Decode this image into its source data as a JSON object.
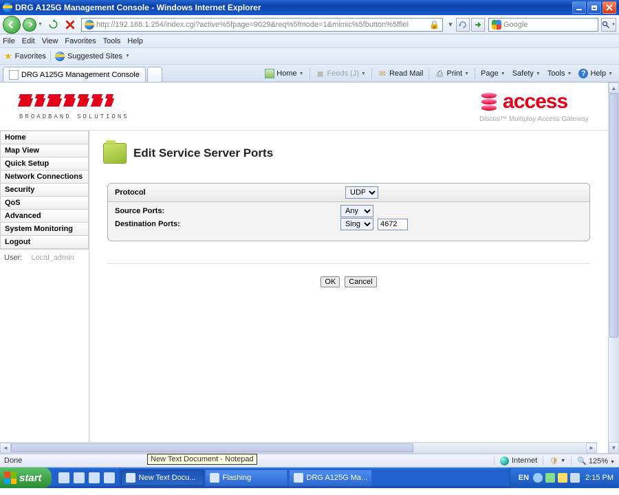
{
  "window": {
    "title": "DRG A125G Management Console - Windows Internet Explorer"
  },
  "address_bar": {
    "url": "http://192.168.1.254/index.cgi?active%5fpage=9029&req%5fmode=1&mimic%5fbutton%5ffiel"
  },
  "search_box": {
    "provider": "Google"
  },
  "menu": {
    "file": "File",
    "edit": "Edit",
    "view": "View",
    "favorites": "Favorites",
    "tools": "Tools",
    "help": "Help"
  },
  "favbar": {
    "favorites": "Favorites",
    "suggested": "Suggested Sites"
  },
  "tab": {
    "title": "DRG A125G Management Console"
  },
  "cmdbar": {
    "home": "Home",
    "feeds": "Feeds (J)",
    "readmail": "Read Mail",
    "print": "Print",
    "page": "Page",
    "safety": "Safety",
    "tools": "Tools",
    "help": "Help"
  },
  "banner": {
    "pirelli_sub": "BROADBAND SOLUTIONS",
    "access": "access",
    "access_sub": "Discus™ Multiplay Access Gateway"
  },
  "sidebar": {
    "items": [
      "Home",
      "Map View",
      "Quick Setup",
      "Network Connections",
      "Security",
      "QoS",
      "Advanced",
      "System Monitoring",
      "Logout"
    ],
    "user_label": "User:",
    "user_name": "Local_admin"
  },
  "main": {
    "title": "Edit Service Server Ports",
    "protocol_label": "Protocol",
    "protocol_value": "UDP",
    "source_label": "Source Ports:",
    "source_value": "Any",
    "dest_label": "Destination Ports:",
    "dest_mode": "Single",
    "dest_value": "4672",
    "ok": "OK",
    "cancel": "Cancel"
  },
  "status": {
    "left": "Done",
    "tooltip": "New Text Document - Notepad",
    "zone": "Internet",
    "zoom": "125%"
  },
  "taskbar": {
    "start": "start",
    "buttons": [
      "New Text Docu...",
      "Flashing",
      "DRG A125G Ma..."
    ],
    "lang": "EN",
    "clock": "2:15 PM"
  }
}
